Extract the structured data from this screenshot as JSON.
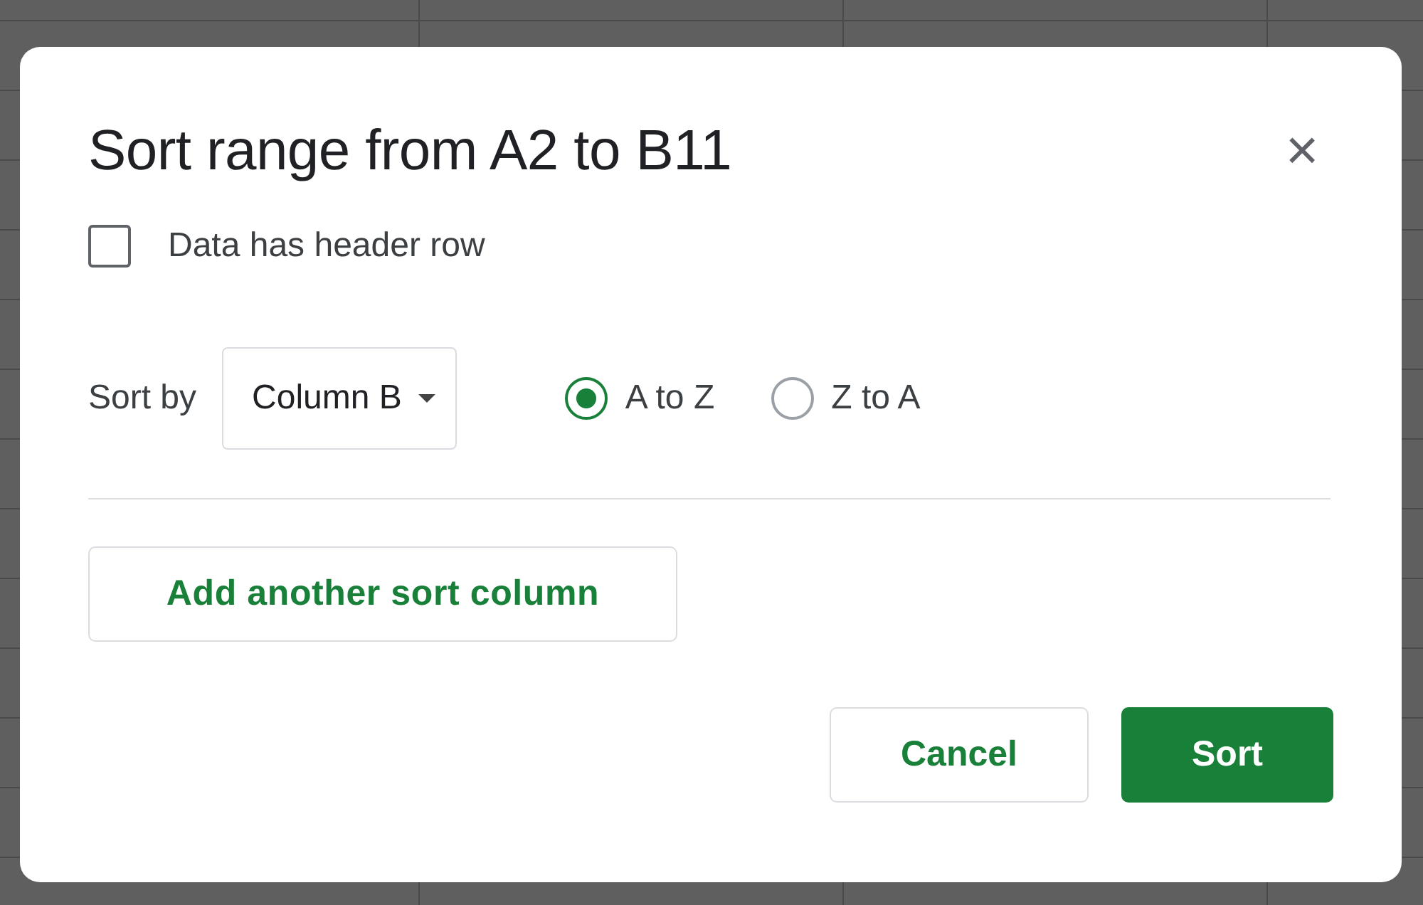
{
  "dialog": {
    "title": "Sort range from A2 to B11",
    "close": "×"
  },
  "header_checkbox": {
    "label": "Data has header row",
    "checked": false
  },
  "sort_by": {
    "label": "Sort by",
    "column": "Column B",
    "options": [
      {
        "label": "A to Z",
        "selected": true
      },
      {
        "label": "Z to A",
        "selected": false
      }
    ]
  },
  "add_button": "Add another sort column",
  "buttons": [
    {
      "label": "Cancel",
      "kind": "secondary"
    },
    {
      "label": "Sort",
      "kind": "primary"
    }
  ]
}
